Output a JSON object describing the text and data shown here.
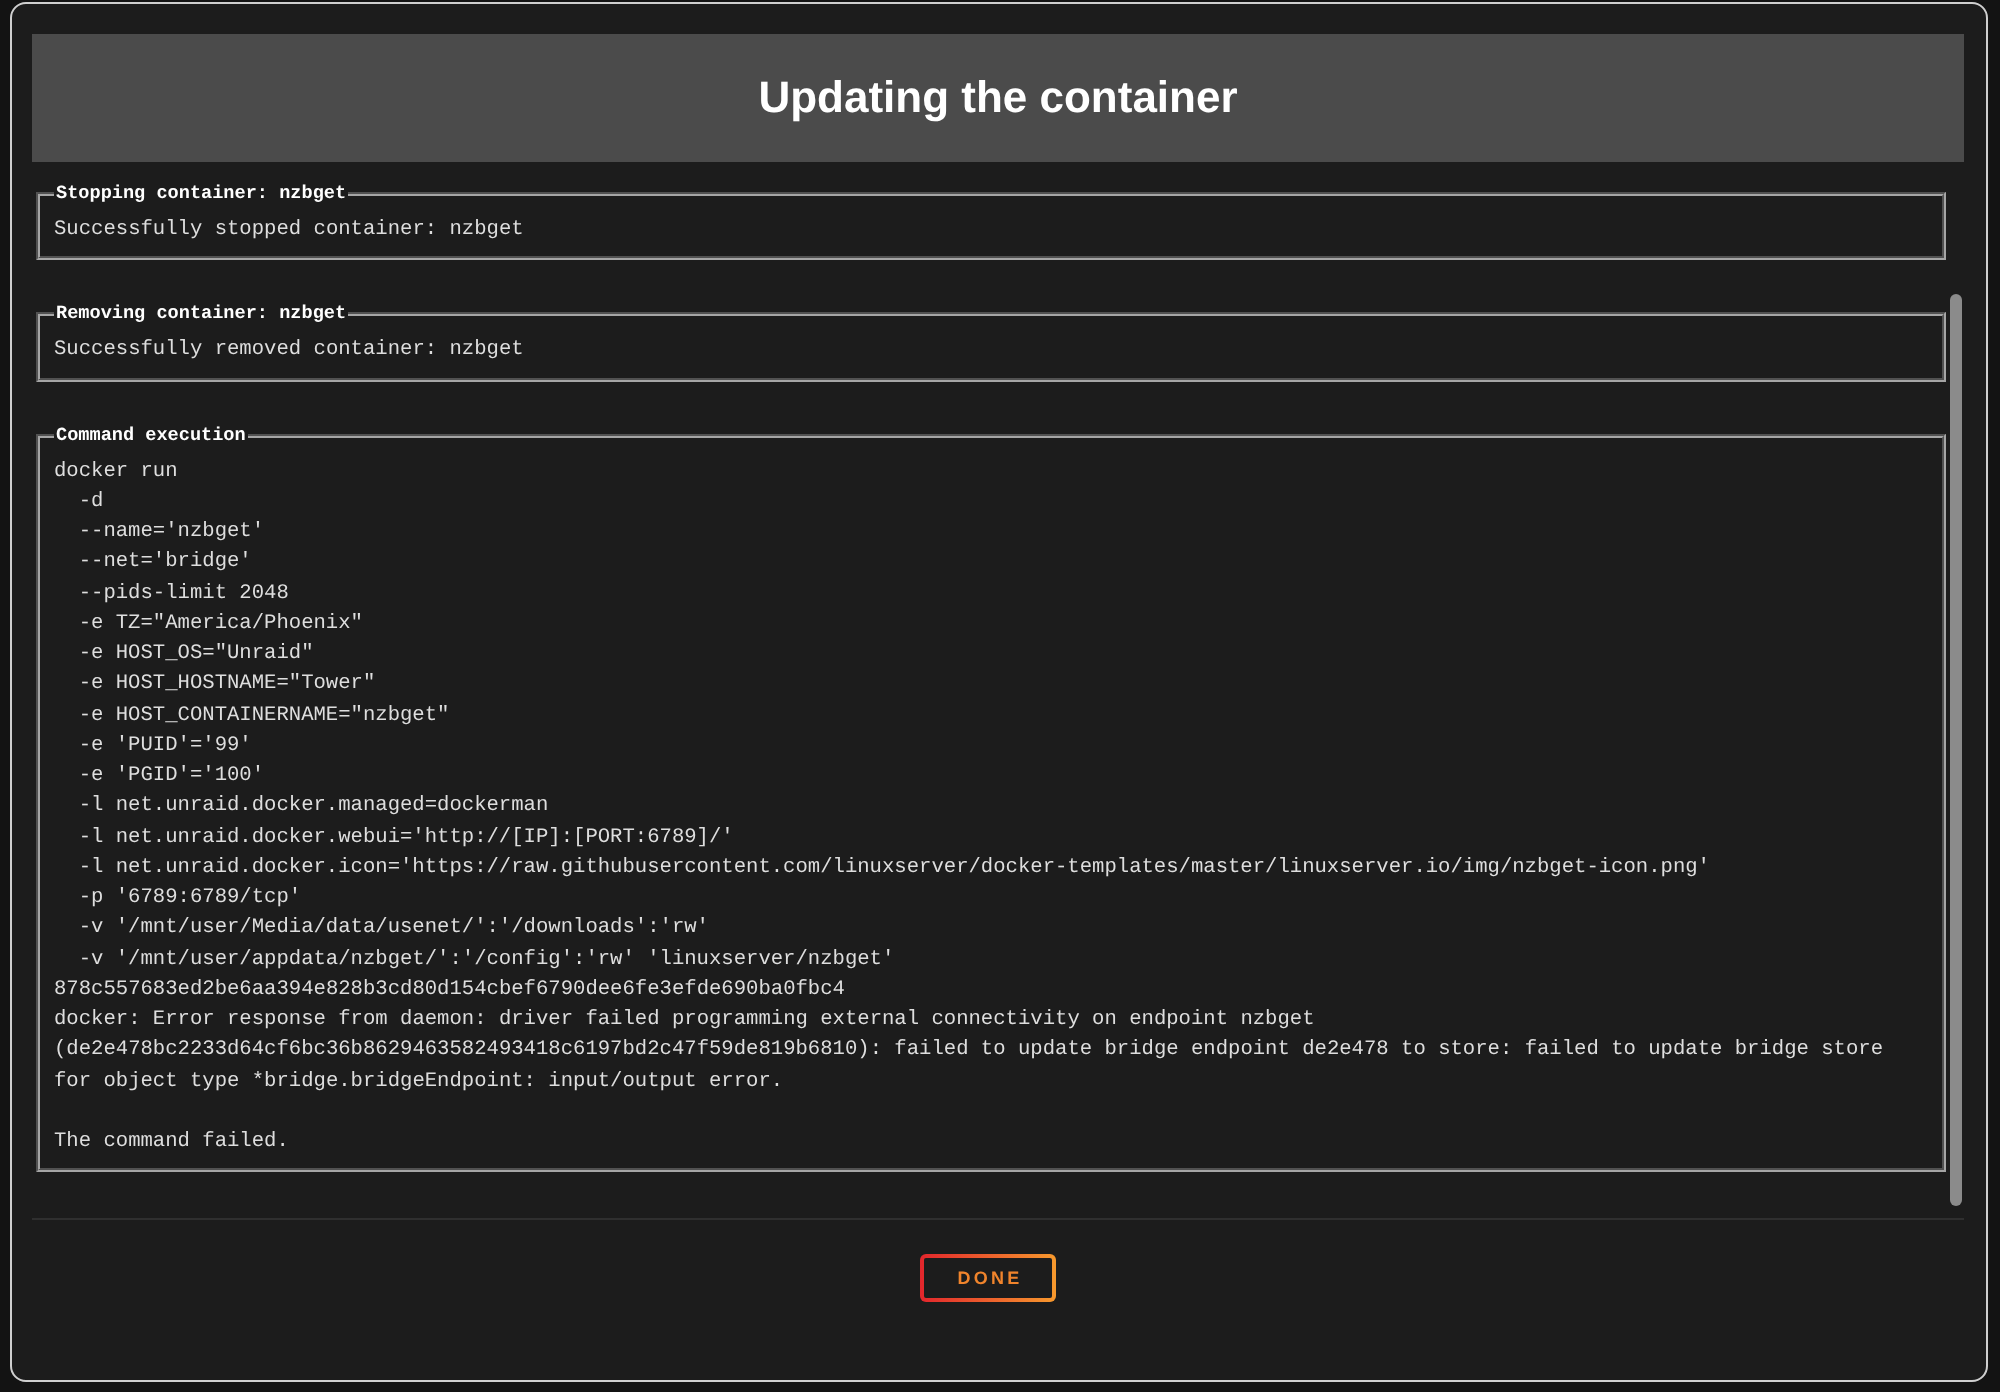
{
  "dialog": {
    "title": "Updating the container"
  },
  "steps": [
    {
      "kind": "message",
      "heading": "Stopping container: nzbget",
      "message": "Successfully stopped container: nzbget"
    },
    {
      "kind": "message",
      "heading": "Removing container: nzbget",
      "message": "Successfully removed container: nzbget"
    },
    {
      "kind": "command",
      "heading": "Command execution",
      "command": "docker run",
      "arguments": [
        "-d",
        "--name='nzbget'",
        "--net='bridge'",
        "--pids-limit 2048",
        "-e TZ=\"America/Phoenix\"",
        "-e HOST_OS=\"Unraid\"",
        "-e HOST_HOSTNAME=\"Tower\"",
        "-e HOST_CONTAINERNAME=\"nzbget\"",
        "-e 'PUID'='99'",
        "-e 'PGID'='100'",
        "-l net.unraid.docker.managed=dockerman",
        "-l net.unraid.docker.webui='http://[IP]:[PORT:6789]/'",
        "-l net.unraid.docker.icon='https://raw.githubusercontent.com/linuxserver/docker-templates/master/linuxserver.io/img/nzbget-icon.png'",
        "-p '6789:6789/tcp'",
        "-v '/mnt/user/Media/data/usenet/':'/downloads':'rw'",
        "-v '/mnt/user/appdata/nzbget/':'/config':'rw' 'linuxserver/nzbget'"
      ],
      "container_id": "878c557683ed2be6aa394e828b3cd80d154cbef6790dee6fe3efde690ba0fbc4",
      "error": "docker: Error response from daemon: driver failed programming external connectivity on endpoint nzbget (de2e478bc2233d64cf6bc36b8629463582493418c6197bd2c47f59de819b6810): failed to update bridge endpoint de2e478 to store: failed to update bridge store for object type *bridge.bridgeEndpoint: input/output error.",
      "result": "The command failed."
    }
  ],
  "buttons": [
    {
      "label": "DONE"
    }
  ]
}
